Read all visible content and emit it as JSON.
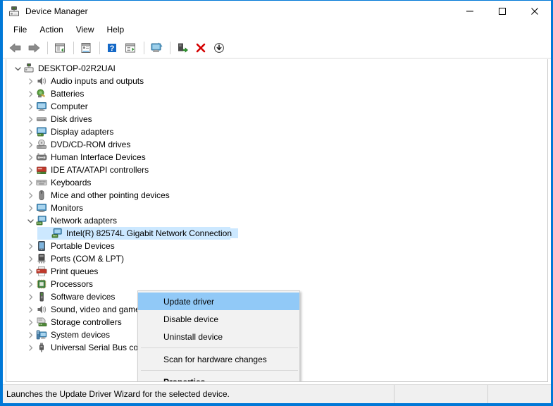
{
  "window": {
    "title": "Device Manager",
    "icon": "device-manager-icon",
    "controls": {
      "minimize": "—",
      "maximize": "☐",
      "close": "✕"
    }
  },
  "menubar": {
    "items": [
      {
        "label": "File"
      },
      {
        "label": "Action"
      },
      {
        "label": "View"
      },
      {
        "label": "Help"
      }
    ]
  },
  "toolbar": {
    "buttons": [
      {
        "name": "back-icon",
        "glyph": "⬅"
      },
      {
        "name": "forward-icon",
        "glyph": "➡"
      },
      {
        "name": "separator-1",
        "glyph": ""
      },
      {
        "name": "show-hidden-devices-icon",
        "glyph": ""
      },
      {
        "name": "separator-2",
        "glyph": ""
      },
      {
        "name": "properties-icon",
        "glyph": ""
      },
      {
        "name": "separator-3",
        "glyph": ""
      },
      {
        "name": "help-icon",
        "glyph": "?"
      },
      {
        "name": "update-driver-icon",
        "glyph": ""
      },
      {
        "name": "separator-4",
        "glyph": ""
      },
      {
        "name": "scan-for-hardware-changes-icon",
        "glyph": ""
      },
      {
        "name": "separator-5",
        "glyph": ""
      },
      {
        "name": "enable-device-icon",
        "glyph": ""
      },
      {
        "name": "uninstall-device-icon",
        "glyph": "✕"
      },
      {
        "name": "disable-device-icon",
        "glyph": "↓"
      }
    ]
  },
  "tree": {
    "items": [
      {
        "label": "DESKTOP-02R2UAI",
        "depth": 0,
        "expanded": true,
        "icon": "computer-root-icon",
        "selected": false
      },
      {
        "label": "Audio inputs and outputs",
        "depth": 1,
        "expanded": false,
        "icon": "speaker-icon",
        "selected": false
      },
      {
        "label": "Batteries",
        "depth": 1,
        "expanded": false,
        "icon": "battery-icon",
        "selected": false
      },
      {
        "label": "Computer",
        "depth": 1,
        "expanded": false,
        "icon": "monitor-icon",
        "selected": false
      },
      {
        "label": "Disk drives",
        "depth": 1,
        "expanded": false,
        "icon": "disk-drive-icon",
        "selected": false
      },
      {
        "label": "Display adapters",
        "depth": 1,
        "expanded": false,
        "icon": "display-adapter-icon",
        "selected": false
      },
      {
        "label": "DVD/CD-ROM drives",
        "depth": 1,
        "expanded": false,
        "icon": "optical-drive-icon",
        "selected": false
      },
      {
        "label": "Human Interface Devices",
        "depth": 1,
        "expanded": false,
        "icon": "hid-icon",
        "selected": false
      },
      {
        "label": "IDE ATA/ATAPI controllers",
        "depth": 1,
        "expanded": false,
        "icon": "ide-controller-icon",
        "selected": false
      },
      {
        "label": "Keyboards",
        "depth": 1,
        "expanded": false,
        "icon": "keyboard-icon",
        "selected": false
      },
      {
        "label": "Mice and other pointing devices",
        "depth": 1,
        "expanded": false,
        "icon": "mouse-icon",
        "selected": false
      },
      {
        "label": "Monitors",
        "depth": 1,
        "expanded": false,
        "icon": "monitor-icon",
        "selected": false
      },
      {
        "label": "Network adapters",
        "depth": 1,
        "expanded": true,
        "icon": "network-adapter-icon",
        "selected": false
      },
      {
        "label": "Intel(R) 82574L Gigabit Network Connection",
        "depth": 2,
        "expanded": null,
        "icon": "network-adapter-icon",
        "selected": true
      },
      {
        "label": "Portable Devices",
        "depth": 1,
        "expanded": false,
        "icon": "portable-device-icon",
        "selected": false
      },
      {
        "label": "Ports (COM & LPT)",
        "depth": 1,
        "expanded": false,
        "icon": "port-icon",
        "selected": false
      },
      {
        "label": "Print queues",
        "depth": 1,
        "expanded": false,
        "icon": "printer-icon",
        "selected": false
      },
      {
        "label": "Processors",
        "depth": 1,
        "expanded": false,
        "icon": "processor-icon",
        "selected": false
      },
      {
        "label": "Software devices",
        "depth": 1,
        "expanded": false,
        "icon": "software-device-icon",
        "selected": false
      },
      {
        "label": "Sound, video and game controllers",
        "depth": 1,
        "expanded": false,
        "icon": "speaker-icon",
        "selected": false
      },
      {
        "label": "Storage controllers",
        "depth": 1,
        "expanded": false,
        "icon": "storage-controller-icon",
        "selected": false
      },
      {
        "label": "System devices",
        "depth": 1,
        "expanded": false,
        "icon": "system-device-icon",
        "selected": false
      },
      {
        "label": "Universal Serial Bus controllers",
        "depth": 1,
        "expanded": false,
        "icon": "usb-icon",
        "selected": false
      }
    ],
    "chevron_collapsed": "❯",
    "chevron_expanded": "⌄"
  },
  "context_menu": {
    "items": [
      {
        "label": "Update driver",
        "highlighted": true,
        "bold": false,
        "separator_after": false
      },
      {
        "label": "Disable device",
        "highlighted": false,
        "bold": false,
        "separator_after": false
      },
      {
        "label": "Uninstall device",
        "highlighted": false,
        "bold": false,
        "separator_after": true
      },
      {
        "label": "Scan for hardware changes",
        "highlighted": false,
        "bold": false,
        "separator_after": true
      },
      {
        "label": "Properties",
        "highlighted": false,
        "bold": true,
        "separator_after": false
      }
    ]
  },
  "statusbar": {
    "message": "Launches the Update Driver Wizard for the selected device.",
    "cell2": "",
    "cell3": ""
  },
  "colors": {
    "window_border": "#0078d7",
    "selection": "#cce8ff",
    "menu_highlight": "#91c9f7",
    "menu_bg": "#f2f2f2",
    "statusbar_bg": "#f0f0f0",
    "chevron": "#767676"
  }
}
